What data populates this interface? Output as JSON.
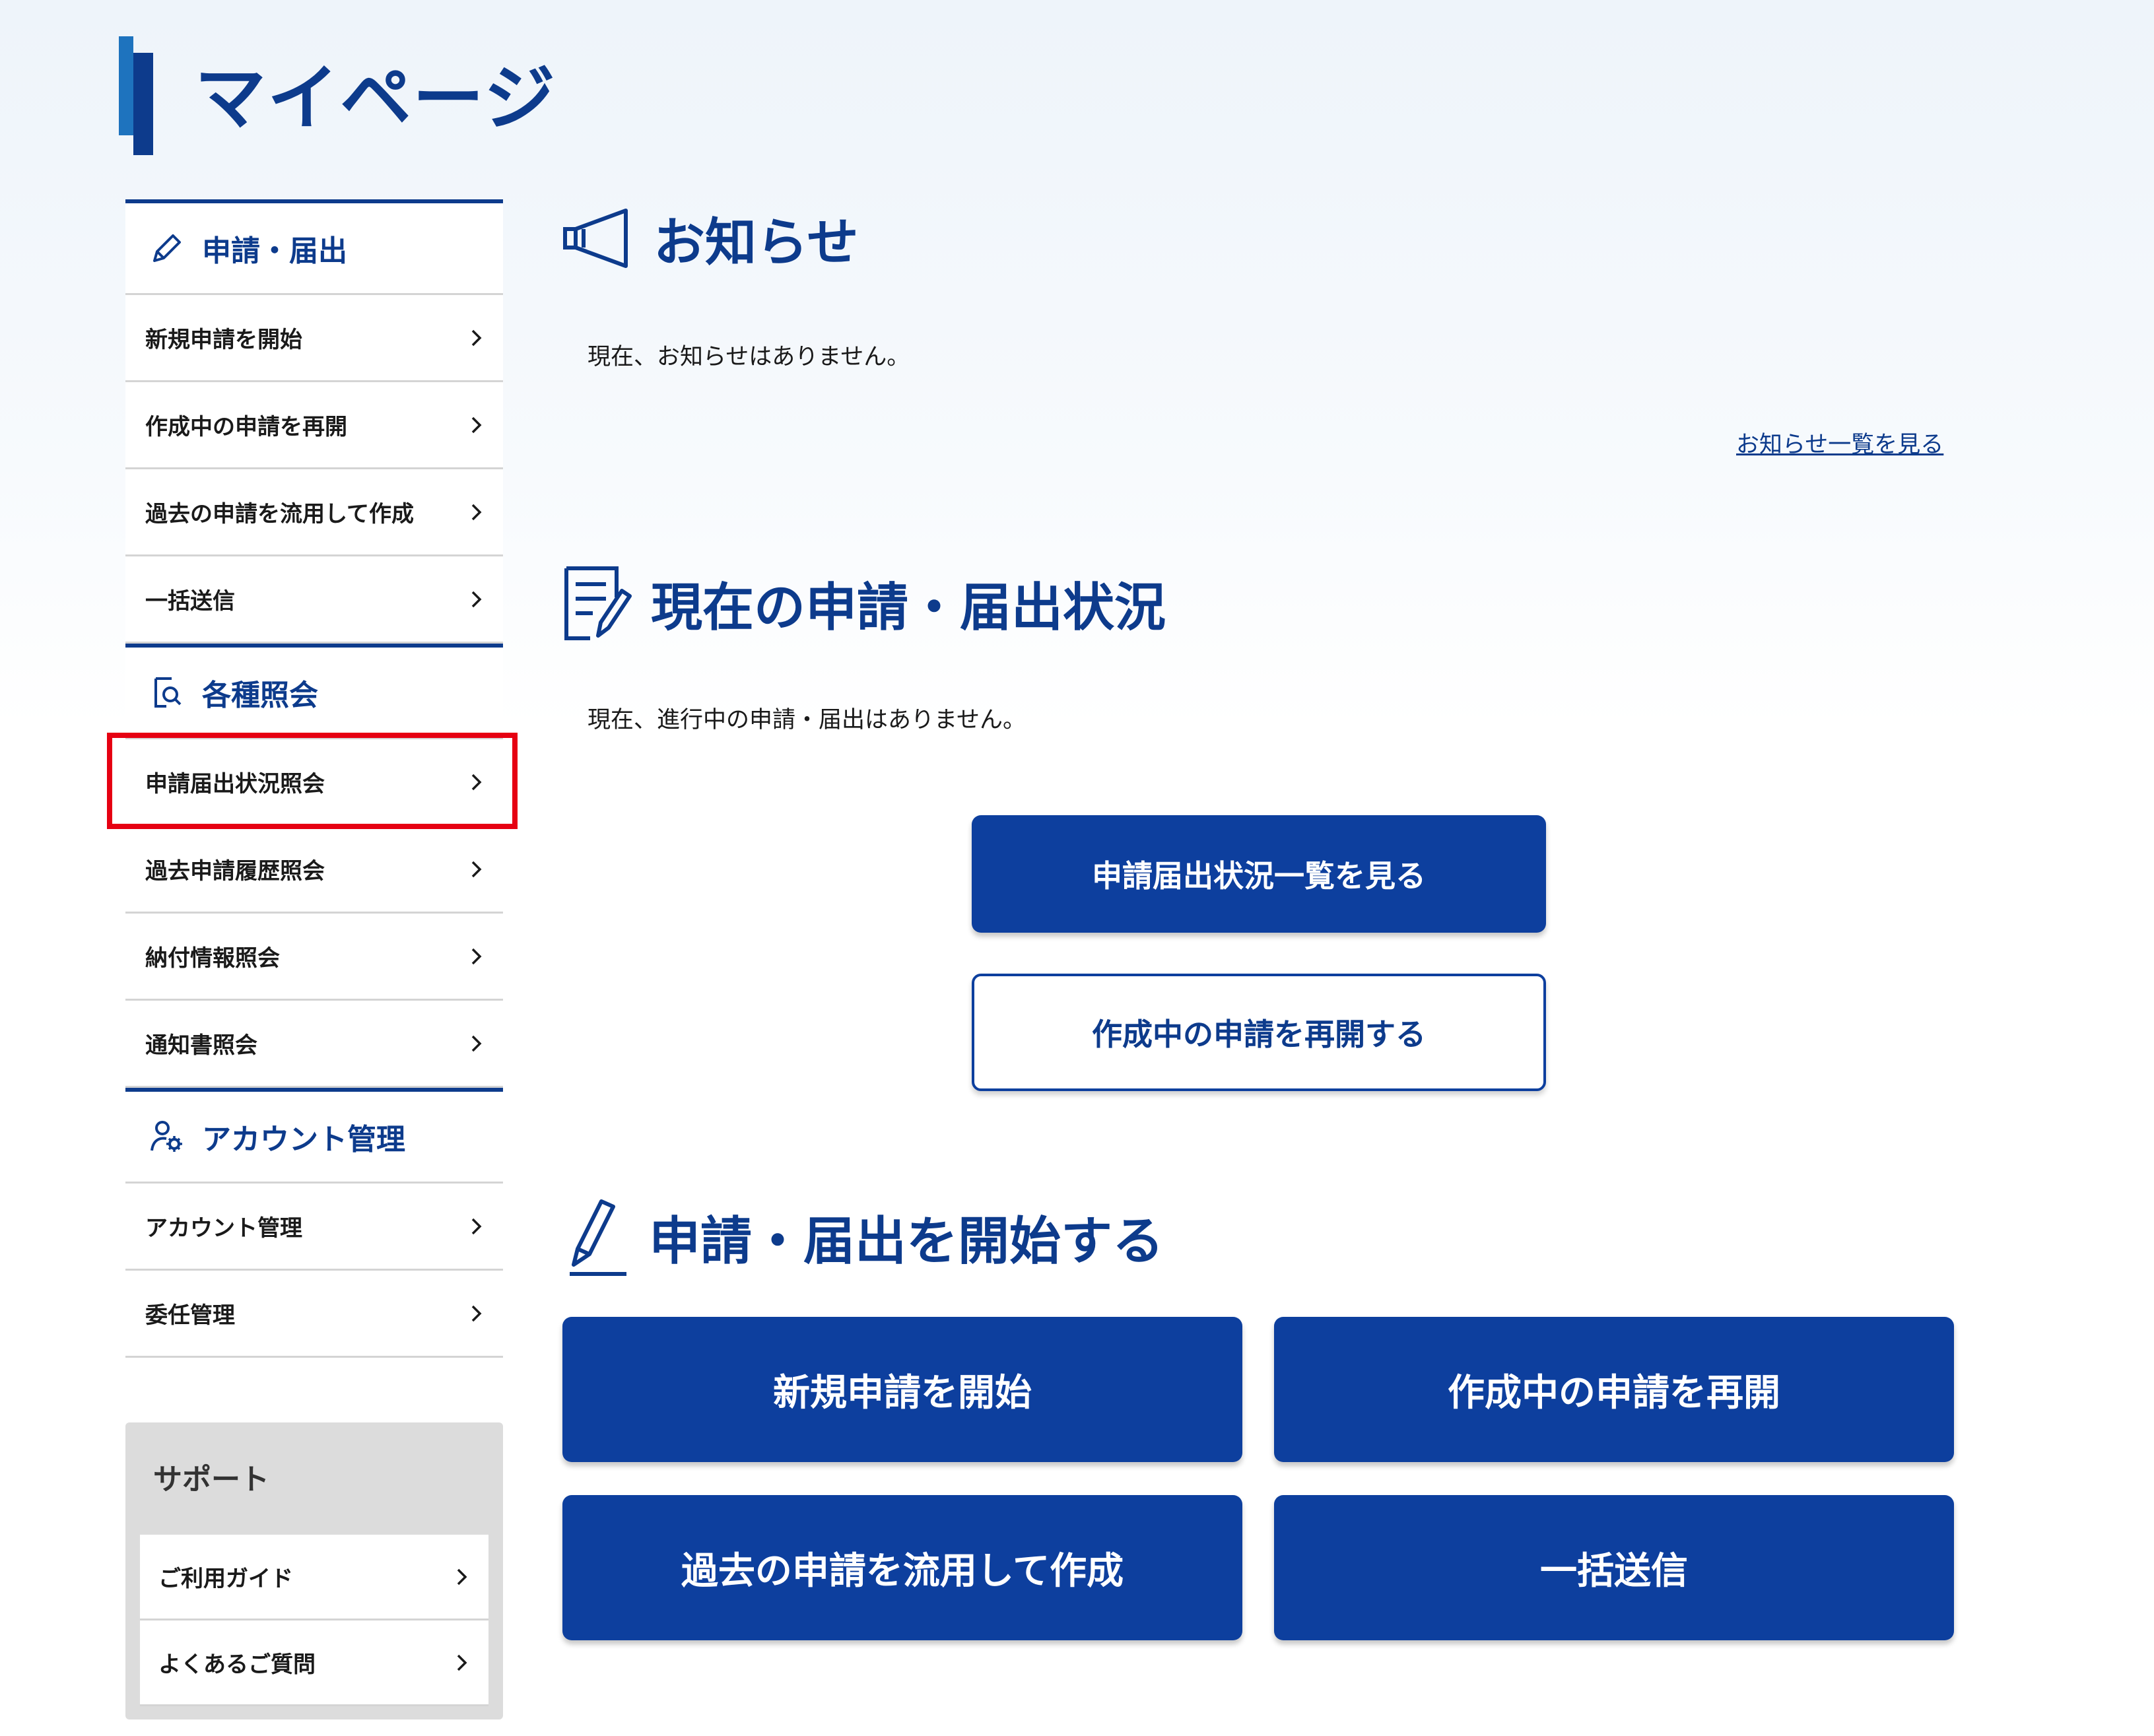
{
  "page_title": "マイページ",
  "sidebar": {
    "sections": [
      {
        "heading": "申請・届出",
        "icon": "pencil-icon",
        "items": [
          {
            "label": "新規申請を開始"
          },
          {
            "label": "作成中の申請を再開"
          },
          {
            "label": "過去の申請を流用して作成"
          },
          {
            "label": "一括送信"
          }
        ]
      },
      {
        "heading": "各種照会",
        "icon": "document-search-icon",
        "items": [
          {
            "label": "申請届出状況照会",
            "highlighted": true
          },
          {
            "label": "過去申請履歴照会"
          },
          {
            "label": "納付情報照会"
          },
          {
            "label": "通知書照会"
          }
        ]
      },
      {
        "heading": "アカウント管理",
        "icon": "user-gear-icon",
        "items": [
          {
            "label": "アカウント管理"
          },
          {
            "label": "委任管理"
          }
        ]
      }
    ],
    "support": {
      "title": "サポート",
      "items": [
        {
          "label": "ご利用ガイド"
        },
        {
          "label": "よくあるご質問"
        }
      ]
    }
  },
  "notices": {
    "title": "お知らせ",
    "icon": "megaphone-icon",
    "empty_text": "現在、お知らせはありません。",
    "link_label": "お知らせ一覧を見る"
  },
  "status": {
    "title": "現在の申請・届出状況",
    "icon": "checklist-icon",
    "empty_text": "現在、進行中の申請・届出はありません。",
    "primary_button": "申請届出状況一覧を見る",
    "secondary_button": "作成中の申請を再開する"
  },
  "start": {
    "title": "申請・届出を開始する",
    "icon": "pen-icon",
    "buttons": [
      {
        "label": "新規申請を開始"
      },
      {
        "label": "作成中の申請を再開"
      },
      {
        "label": "過去の申請を流用して作成"
      },
      {
        "label": "一括送信"
      }
    ]
  },
  "colors": {
    "brand": "#0d3b8c",
    "button": "#0d3f9e",
    "highlight": "#e60012"
  }
}
